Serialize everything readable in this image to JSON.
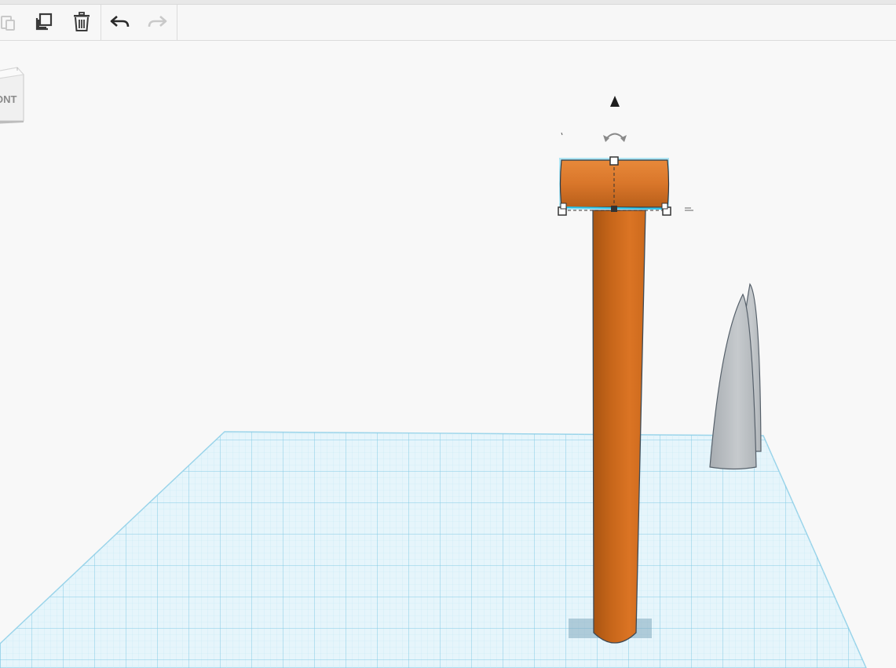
{
  "toolbar": {
    "edit_group": [
      {
        "name": "paste",
        "icon": "paste-icon",
        "enabled": false
      },
      {
        "name": "duplicate",
        "icon": "duplicate-icon",
        "enabled": true
      },
      {
        "name": "delete",
        "icon": "trash-icon",
        "enabled": true
      }
    ],
    "history_group": [
      {
        "name": "undo",
        "icon": "undo-icon",
        "enabled": true
      },
      {
        "name": "redo",
        "icon": "redo-icon",
        "enabled": false
      }
    ]
  },
  "view_cube": {
    "face_label": "ONT"
  },
  "scene": {
    "workplane_color": "#aee0f2",
    "selected_shape": "cylinder",
    "selected_color": "#d86f1e",
    "selection_outline": "#29c3ea",
    "post_color": "#d06d18",
    "grey_shape": "paraboloid",
    "grey_color": "#b9bec3"
  }
}
